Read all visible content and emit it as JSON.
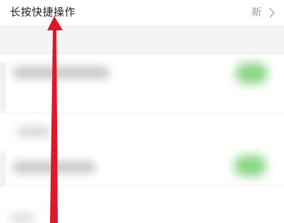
{
  "setting": {
    "title": "长按快捷操作",
    "value": "新"
  },
  "icons": {
    "chevron": "chevron-right-icon",
    "arrow": "red-arrow-annotation"
  },
  "colors": {
    "annotation_red": "#e0172a",
    "toggle_green": "#4cd964",
    "secondary_text": "#9a9a9a"
  }
}
